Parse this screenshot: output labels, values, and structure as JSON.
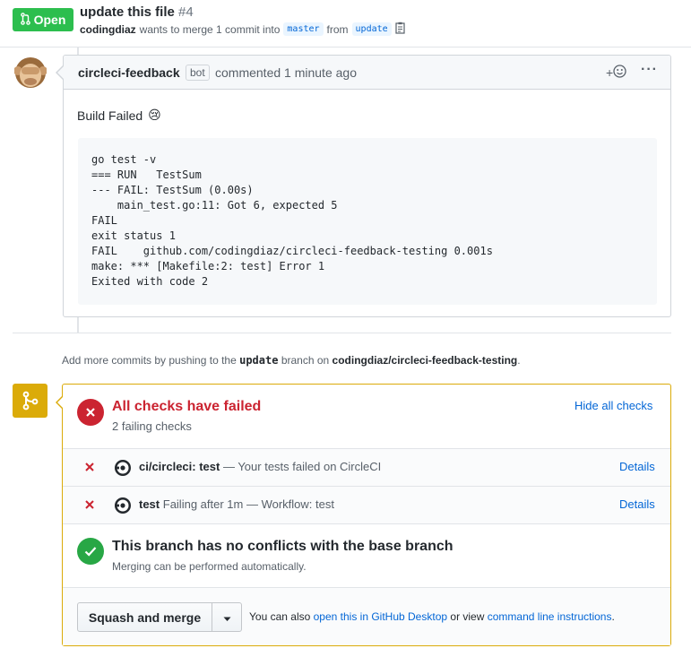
{
  "header": {
    "state_label": "Open",
    "title": "update this file",
    "number": "#4",
    "author": "codingdiaz",
    "merge_text": "wants to merge 1 commit into",
    "base_branch": "master",
    "from_text": "from",
    "head_branch": "update"
  },
  "comment": {
    "author": "circleci-feedback",
    "bot_label": "bot",
    "commented_text": "commented 1 minute ago",
    "body_text": "Build Failed",
    "emoji": "😢",
    "code_lines": [
      "go test -v",
      "=== RUN   TestSum",
      "--- FAIL: TestSum (0.00s)",
      "    main_test.go:11: Got 6, expected 5",
      "FAIL",
      "exit status 1",
      "FAIL    github.com/codingdiaz/circleci-feedback-testing 0.001s",
      "make: *** [Makefile:2: test] Error 1",
      "Exited with code 2"
    ]
  },
  "push_hint": {
    "prefix": "Add more commits by pushing to the",
    "branch": "update",
    "middle": "branch on",
    "repo": "codingdiaz/circleci-feedback-testing",
    "suffix": "."
  },
  "checks": {
    "title": "All checks have failed",
    "subtitle": "2 failing checks",
    "toggle_label": "Hide all checks",
    "items": [
      {
        "name": "ci/circleci: test",
        "description": "— Your tests failed on CircleCI",
        "details_label": "Details"
      },
      {
        "name": "test",
        "description": "Failing after 1m — Workflow: test",
        "details_label": "Details"
      }
    ]
  },
  "conflicts": {
    "title": "This branch has no conflicts with the base branch",
    "subtitle": "Merging can be performed automatically."
  },
  "merge": {
    "button_label": "Squash and merge",
    "also_text": "You can also",
    "desktop_link": "open this in GitHub Desktop",
    "or_text": "or view",
    "cli_link": "command line instructions",
    "end_text": "."
  },
  "colors": {
    "open_green": "#2cbe4e",
    "fail_red": "#cb2431",
    "success_green": "#28a745",
    "pending_yellow": "#dbab09",
    "link_blue": "#0366d6"
  }
}
